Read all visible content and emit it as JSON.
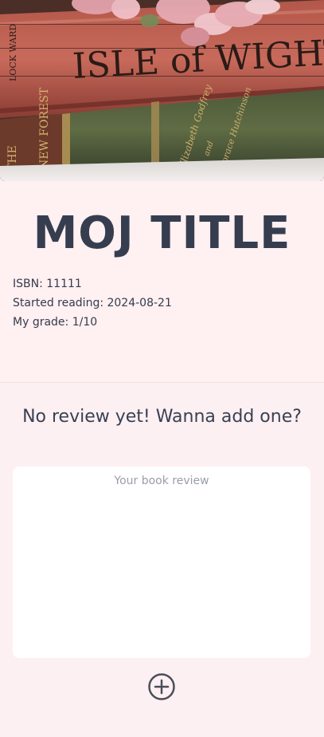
{
  "book": {
    "title": "MOJ TITLE",
    "isbn": "ISBN: 11111",
    "started": "Started reading: 2024-08-21",
    "grade": "My grade: 1/10"
  },
  "cover_image": {
    "spine_text_top": "ISLE of WIGHT",
    "spine_text_left_top": "LOCK WARD",
    "spine_text_bottom_left": "THE",
    "spine_text_bottom_mid": "NEW FOREST",
    "spine_text_bottom_right_1": "Elizabeth Godfrey",
    "spine_text_bottom_right_2": "and",
    "spine_text_bottom_right_3": "Horace Hutchinson"
  },
  "review": {
    "empty_message": "No review yet! Wanna add one?",
    "placeholder": "Your book review"
  },
  "icons": {
    "add": "plus-circle-icon"
  }
}
